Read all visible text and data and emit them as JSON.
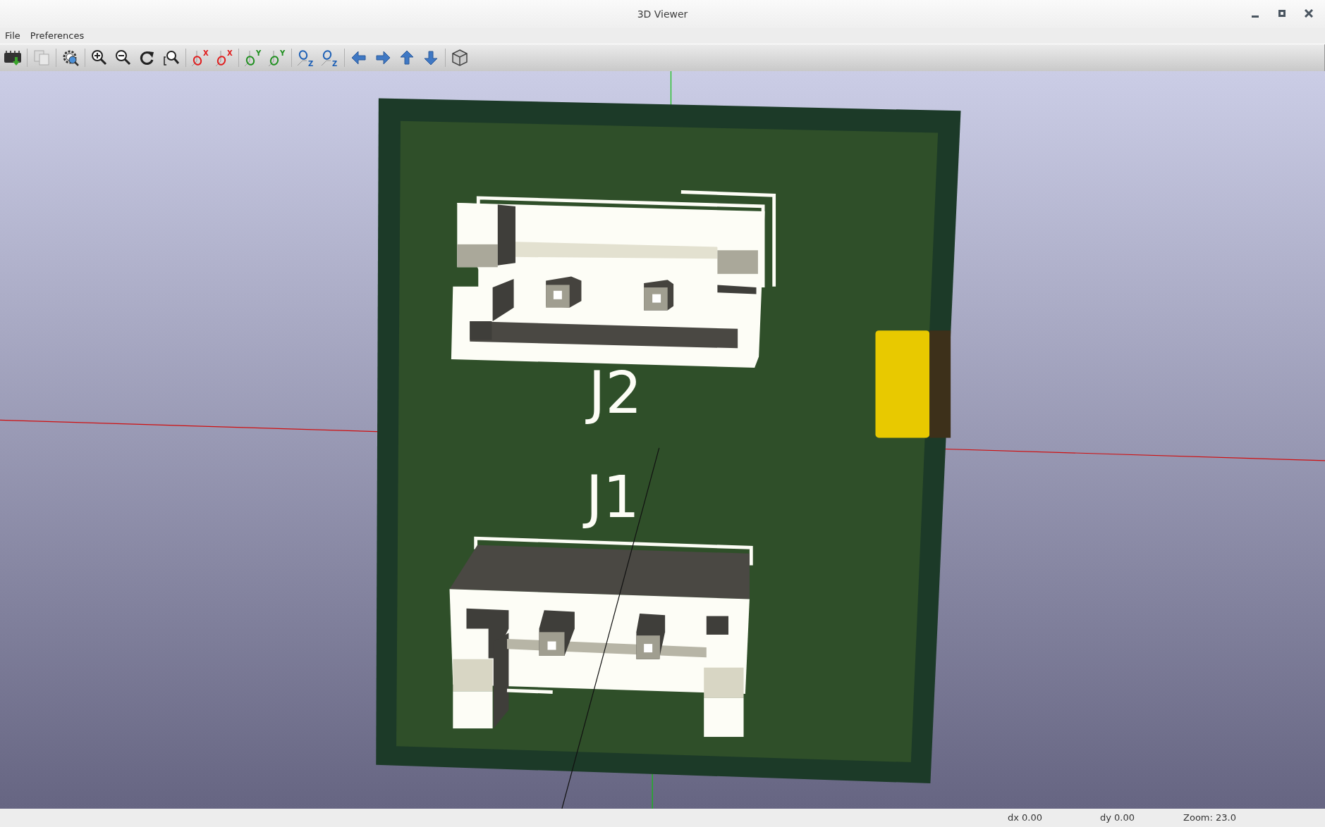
{
  "window": {
    "title": "3D Viewer"
  },
  "menu": [
    "File",
    "Preferences"
  ],
  "toolbar": [
    [
      {
        "kind": "export"
      }
    ],
    [
      {
        "kind": "copy"
      }
    ],
    [
      {
        "kind": "settings"
      }
    ],
    [
      {
        "kind": "zoom_in"
      },
      {
        "kind": "zoom_out"
      },
      {
        "kind": "redraw"
      },
      {
        "kind": "zoom_fit"
      }
    ],
    [
      {
        "kind": "rotate",
        "axis": "X"
      },
      {
        "kind": "rotate_back",
        "axis": "X"
      }
    ],
    [
      {
        "kind": "rotate",
        "axis": "Y"
      },
      {
        "kind": "rotate_back",
        "axis": "Y"
      }
    ],
    [
      {
        "kind": "rotate",
        "axis": "Z"
      },
      {
        "kind": "rotate_back",
        "axis": "Z"
      }
    ],
    [
      {
        "kind": "move_left"
      },
      {
        "kind": "move_right"
      },
      {
        "kind": "move_up"
      },
      {
        "kind": "move_down"
      }
    ],
    [
      {
        "kind": "ortho"
      }
    ]
  ],
  "viewport": {
    "silkscreen_labels": [
      "J2",
      "J1"
    ]
  },
  "status_bar": [
    "dx 0.00",
    "dy 0.00",
    "Zoom: 23.0"
  ]
}
